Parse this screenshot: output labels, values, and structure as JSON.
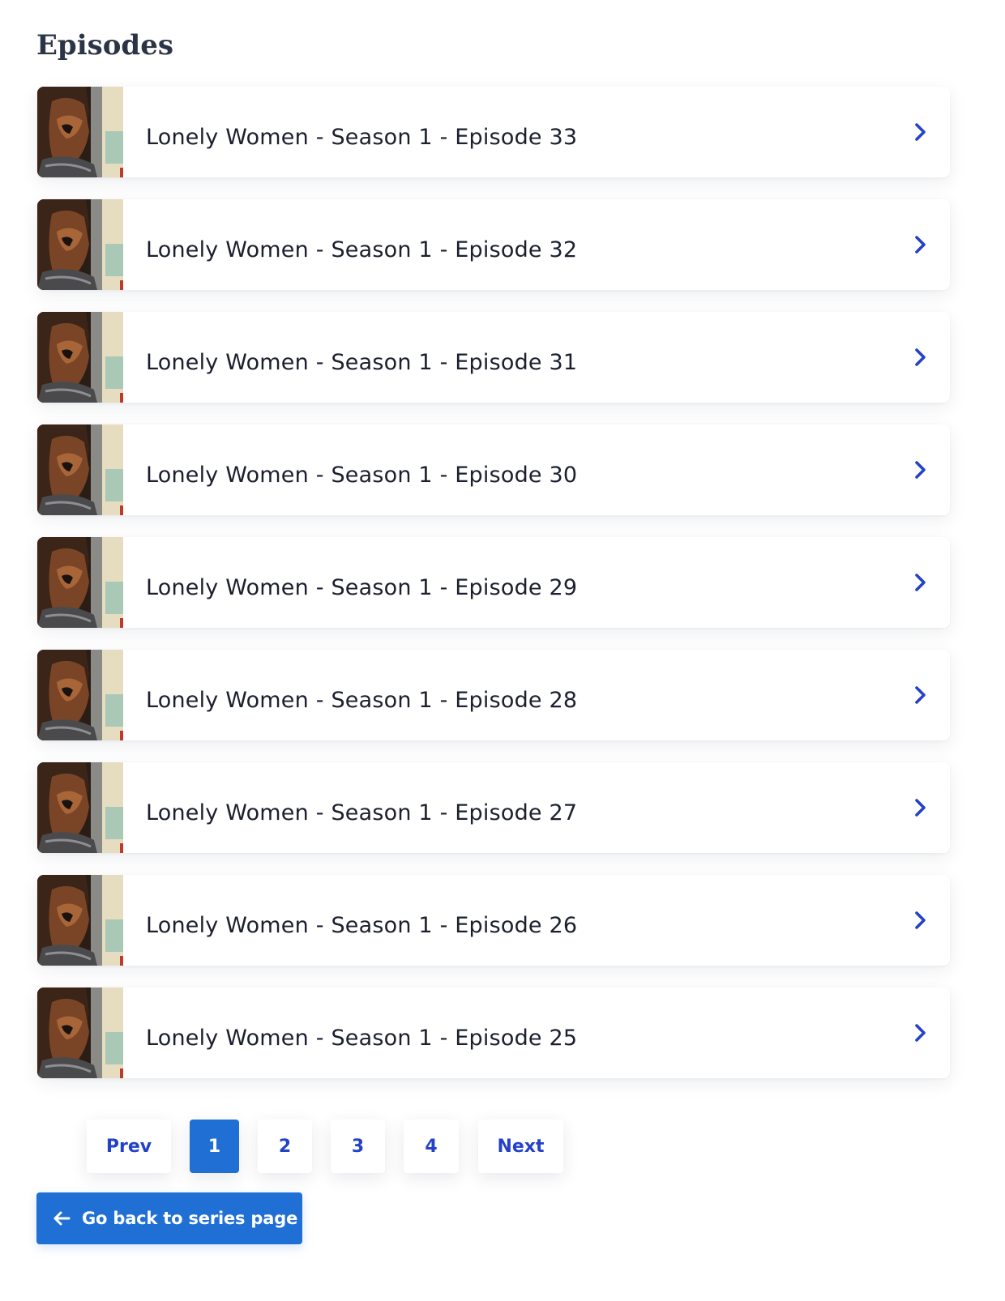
{
  "page": {
    "title": "Episodes"
  },
  "colors": {
    "accent": "#2342c8",
    "primary_button": "#1f6fd4",
    "text": "#1c1f2e",
    "heading": "#2c3447"
  },
  "episodes": [
    {
      "title": "Lonely Women - Season 1 - Episode 33",
      "icon": "chevron-right-icon"
    },
    {
      "title": "Lonely Women - Season 1 - Episode 32",
      "icon": "chevron-right-icon"
    },
    {
      "title": "Lonely Women - Season 1 - Episode 31",
      "icon": "chevron-right-icon"
    },
    {
      "title": "Lonely Women - Season 1 - Episode 30",
      "icon": "chevron-right-icon"
    },
    {
      "title": "Lonely Women - Season 1 - Episode 29",
      "icon": "chevron-right-icon"
    },
    {
      "title": "Lonely Women - Season 1 - Episode 28",
      "icon": "chevron-right-icon"
    },
    {
      "title": "Lonely Women - Season 1 - Episode 27",
      "icon": "chevron-right-icon"
    },
    {
      "title": "Lonely Women - Season 1 - Episode 26",
      "icon": "chevron-right-icon"
    },
    {
      "title": "Lonely Women - Season 1 - Episode 25",
      "icon": "chevron-right-icon"
    }
  ],
  "pagination": {
    "prev_label": "Prev",
    "next_label": "Next",
    "pages": [
      "1",
      "2",
      "3",
      "4"
    ],
    "current_page": "1"
  },
  "back_button": {
    "label": "Go back to series page",
    "icon": "arrow-left-icon"
  }
}
